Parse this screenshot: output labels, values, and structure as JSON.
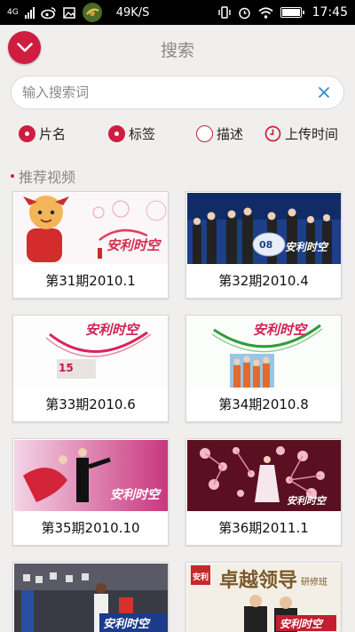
{
  "status_bar": {
    "network": "4G",
    "speed": "49K/S",
    "time": "17:45"
  },
  "header": {
    "title": "搜索"
  },
  "search": {
    "placeholder": "输入搜索词",
    "value": ""
  },
  "filters": [
    {
      "label": "片名",
      "selected": true
    },
    {
      "label": "标签",
      "selected": true
    },
    {
      "label": "描述",
      "selected": false
    },
    {
      "label": "上传时间",
      "selected": false
    }
  ],
  "section": {
    "title": "推荐视频"
  },
  "videos": [
    {
      "title": "第31期2010.1"
    },
    {
      "title": "第32期2010.4"
    },
    {
      "title": "第33期2010.6"
    },
    {
      "title": "第34期2010.8"
    },
    {
      "title": "第35期2010.10"
    },
    {
      "title": "第36期2011.1"
    },
    {
      "title": ""
    },
    {
      "title": ""
    }
  ],
  "thumb_texts": {
    "brand": "安利时空",
    "brand_short": "安利",
    "banner_big": "卓越领导",
    "banner_small": "研修班",
    "fifteen": "15"
  },
  "colors": {
    "accent": "#cf1d41",
    "background": "#f0efed",
    "status_bar": "#000000"
  }
}
